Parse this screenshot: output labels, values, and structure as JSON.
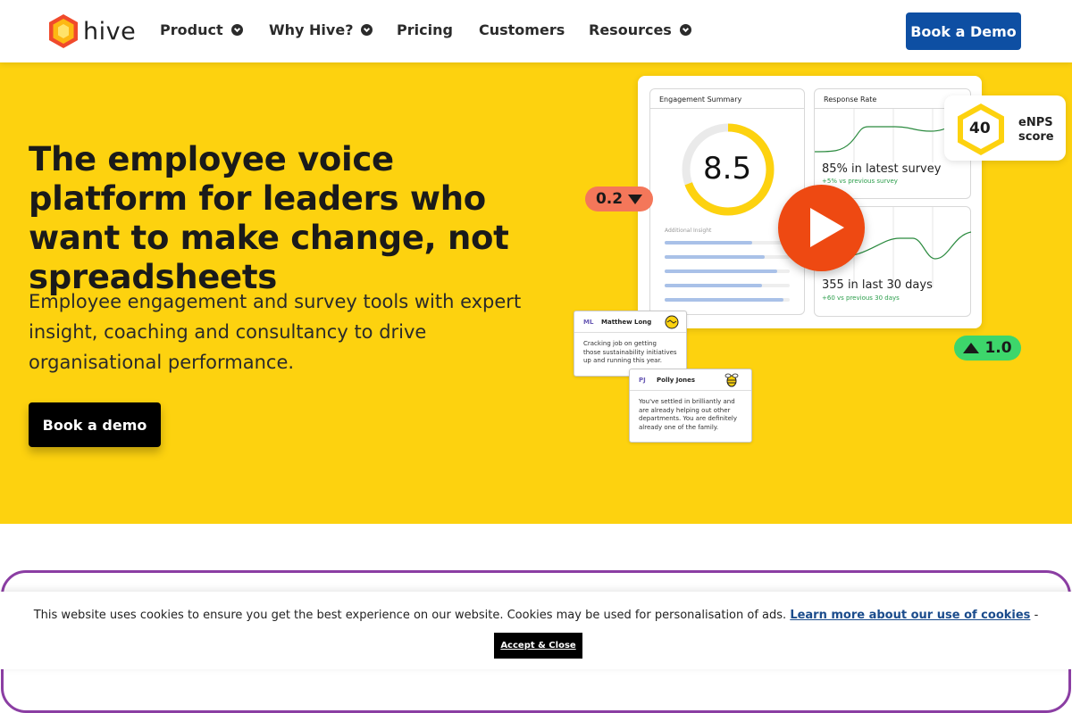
{
  "nav": {
    "logo_text": "hive",
    "items": [
      {
        "label": "Product",
        "has_dropdown": true
      },
      {
        "label": "Why Hive?",
        "has_dropdown": true
      },
      {
        "label": "Pricing",
        "has_dropdown": false
      },
      {
        "label": "Customers",
        "has_dropdown": false
      },
      {
        "label": "Resources",
        "has_dropdown": true
      }
    ],
    "cta_label": "Book a Demo"
  },
  "hero": {
    "title": "The employee voice platform for leaders who want to make change, not spreadsheets",
    "subtitle": "Employee engagement and survey tools with expert insight, coaching and consultancy to drive organisational performance.",
    "cta_label": "Book a demo"
  },
  "dashboard": {
    "engagement_summary": {
      "title": "Engagement Summary",
      "score": "8.5",
      "additional_label": "Additional Insight"
    },
    "response_rate": {
      "title": "Response Rate",
      "stat": "85% in latest survey",
      "sub": "+5% vs previous survey"
    },
    "activity": {
      "stat": "355 in last 30 days",
      "sub": "+60 vs previous 30 days"
    },
    "change_down": {
      "value": "0.2",
      "direction": "down"
    },
    "change_up": {
      "value": "1.0",
      "direction": "up"
    },
    "enps": {
      "score": "40",
      "label_line1": "eNPS",
      "label_line2": "score"
    },
    "comments": [
      {
        "initials": "ML",
        "name": "Matthew Long",
        "text_lines": [
          "Cracking job on getting",
          "those sustainability initiatives",
          "up and running this year."
        ],
        "icon": "handshake-icon"
      },
      {
        "initials": "PJ",
        "name": "Polly Jones",
        "text_lines": [
          "You've settled in brilliantly and",
          "are already helping out other",
          "departments. You are definitely",
          "already one of the family."
        ],
        "icon": "bee-icon"
      }
    ]
  },
  "cookie_banner": {
    "text": "This website uses cookies to ensure you get the best experience on our website. Cookies may be used for personalisation of ads.",
    "link_label": "Learn more about our use of cookies",
    "suffix": "-",
    "button_label": "Accept & Close"
  },
  "colors": {
    "hero_background": "#fdd20f",
    "primary_blue": "#0e4fa3",
    "play_orange": "#ee4912",
    "accent_purple": "#8b3ea3",
    "down_pill": "#f4775a",
    "up_pill": "#3dd66b"
  }
}
